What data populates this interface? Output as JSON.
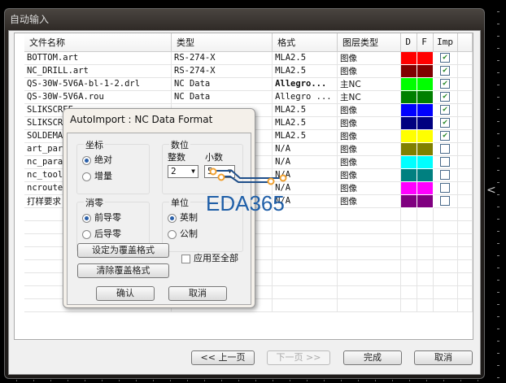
{
  "window": {
    "title": "自动输入"
  },
  "table": {
    "headers": [
      "文件名称",
      "类型",
      "格式",
      "图层类型",
      "D",
      "F",
      "Imp"
    ],
    "rows": [
      {
        "name": "BOTTOM.art",
        "type": "RS-274-X",
        "format": "MLA2.5",
        "layer": "图像",
        "color": "#ff0000",
        "imp": true
      },
      {
        "name": "NC_DRILL.art",
        "type": "RS-274-X",
        "format": "MLA2.5",
        "layer": "图像",
        "color": "#800000",
        "imp": true
      },
      {
        "name": "QS-30W-5V6A-bl-1-2.drl",
        "type": "NC Data",
        "format": "Allegro...",
        "layer": "主NC",
        "color": "#00ff00",
        "imp": true,
        "bold": true
      },
      {
        "name": "QS-30W-5V6A.rou",
        "type": "NC Data",
        "format": "Allegro ...",
        "layer": "主NC",
        "color": "#008000",
        "imp": true
      },
      {
        "name": "SLIKSCREE",
        "type": "",
        "format": "MLA2.5",
        "layer": "图像",
        "color": "#0000ff",
        "imp": true
      },
      {
        "name": "SLIKSCREE",
        "type": "",
        "format": "MLA2.5",
        "layer": "图像",
        "color": "#000080",
        "imp": true
      },
      {
        "name": "SOLDEMASK",
        "type": "",
        "format": "MLA2.5",
        "layer": "图像",
        "color": "#ffff00",
        "imp": true
      },
      {
        "name": "art_param",
        "type": "",
        "format": "N/A",
        "layer": "图像",
        "color": "#808000",
        "imp": false
      },
      {
        "name": "nc_param",
        "type": "",
        "format": "N/A",
        "layer": "图像",
        "color": "#00ffff",
        "imp": false
      },
      {
        "name": "nc_tools",
        "type": "",
        "format": "N/A",
        "layer": "图像",
        "color": "#008080",
        "imp": false
      },
      {
        "name": "ncrouteb",
        "type": "",
        "format": "N/A",
        "layer": "图像",
        "color": "#ff00ff",
        "imp": false
      },
      {
        "name": "打样要求",
        "type": "",
        "format": "N/A",
        "layer": "图像",
        "color": "#800080",
        "imp": false
      }
    ]
  },
  "buttons": {
    "prev": "<<  上一页",
    "next": "下一页  >>",
    "finish": "完成",
    "cancel": "取消"
  },
  "dialog": {
    "title": "AutoImport : NC Data Format",
    "coord": {
      "label": "坐标",
      "options": [
        "绝对",
        "增量"
      ],
      "selected": 0
    },
    "digits": {
      "label": "数位",
      "int_label": "整数",
      "int_value": "2",
      "dec_label": "小数",
      "dec_value": "5"
    },
    "zeros": {
      "label": "消零",
      "options": [
        "前导零",
        "后导零"
      ],
      "selected": 0
    },
    "units": {
      "label": "单位",
      "options": [
        "英制",
        "公制"
      ],
      "selected": 0
    },
    "set_override": "设定为覆盖格式",
    "clear_override": "清除覆盖格式",
    "apply_all": "应用至全部",
    "ok": "确认",
    "cancel": "取消"
  },
  "watermark": "EDA365"
}
